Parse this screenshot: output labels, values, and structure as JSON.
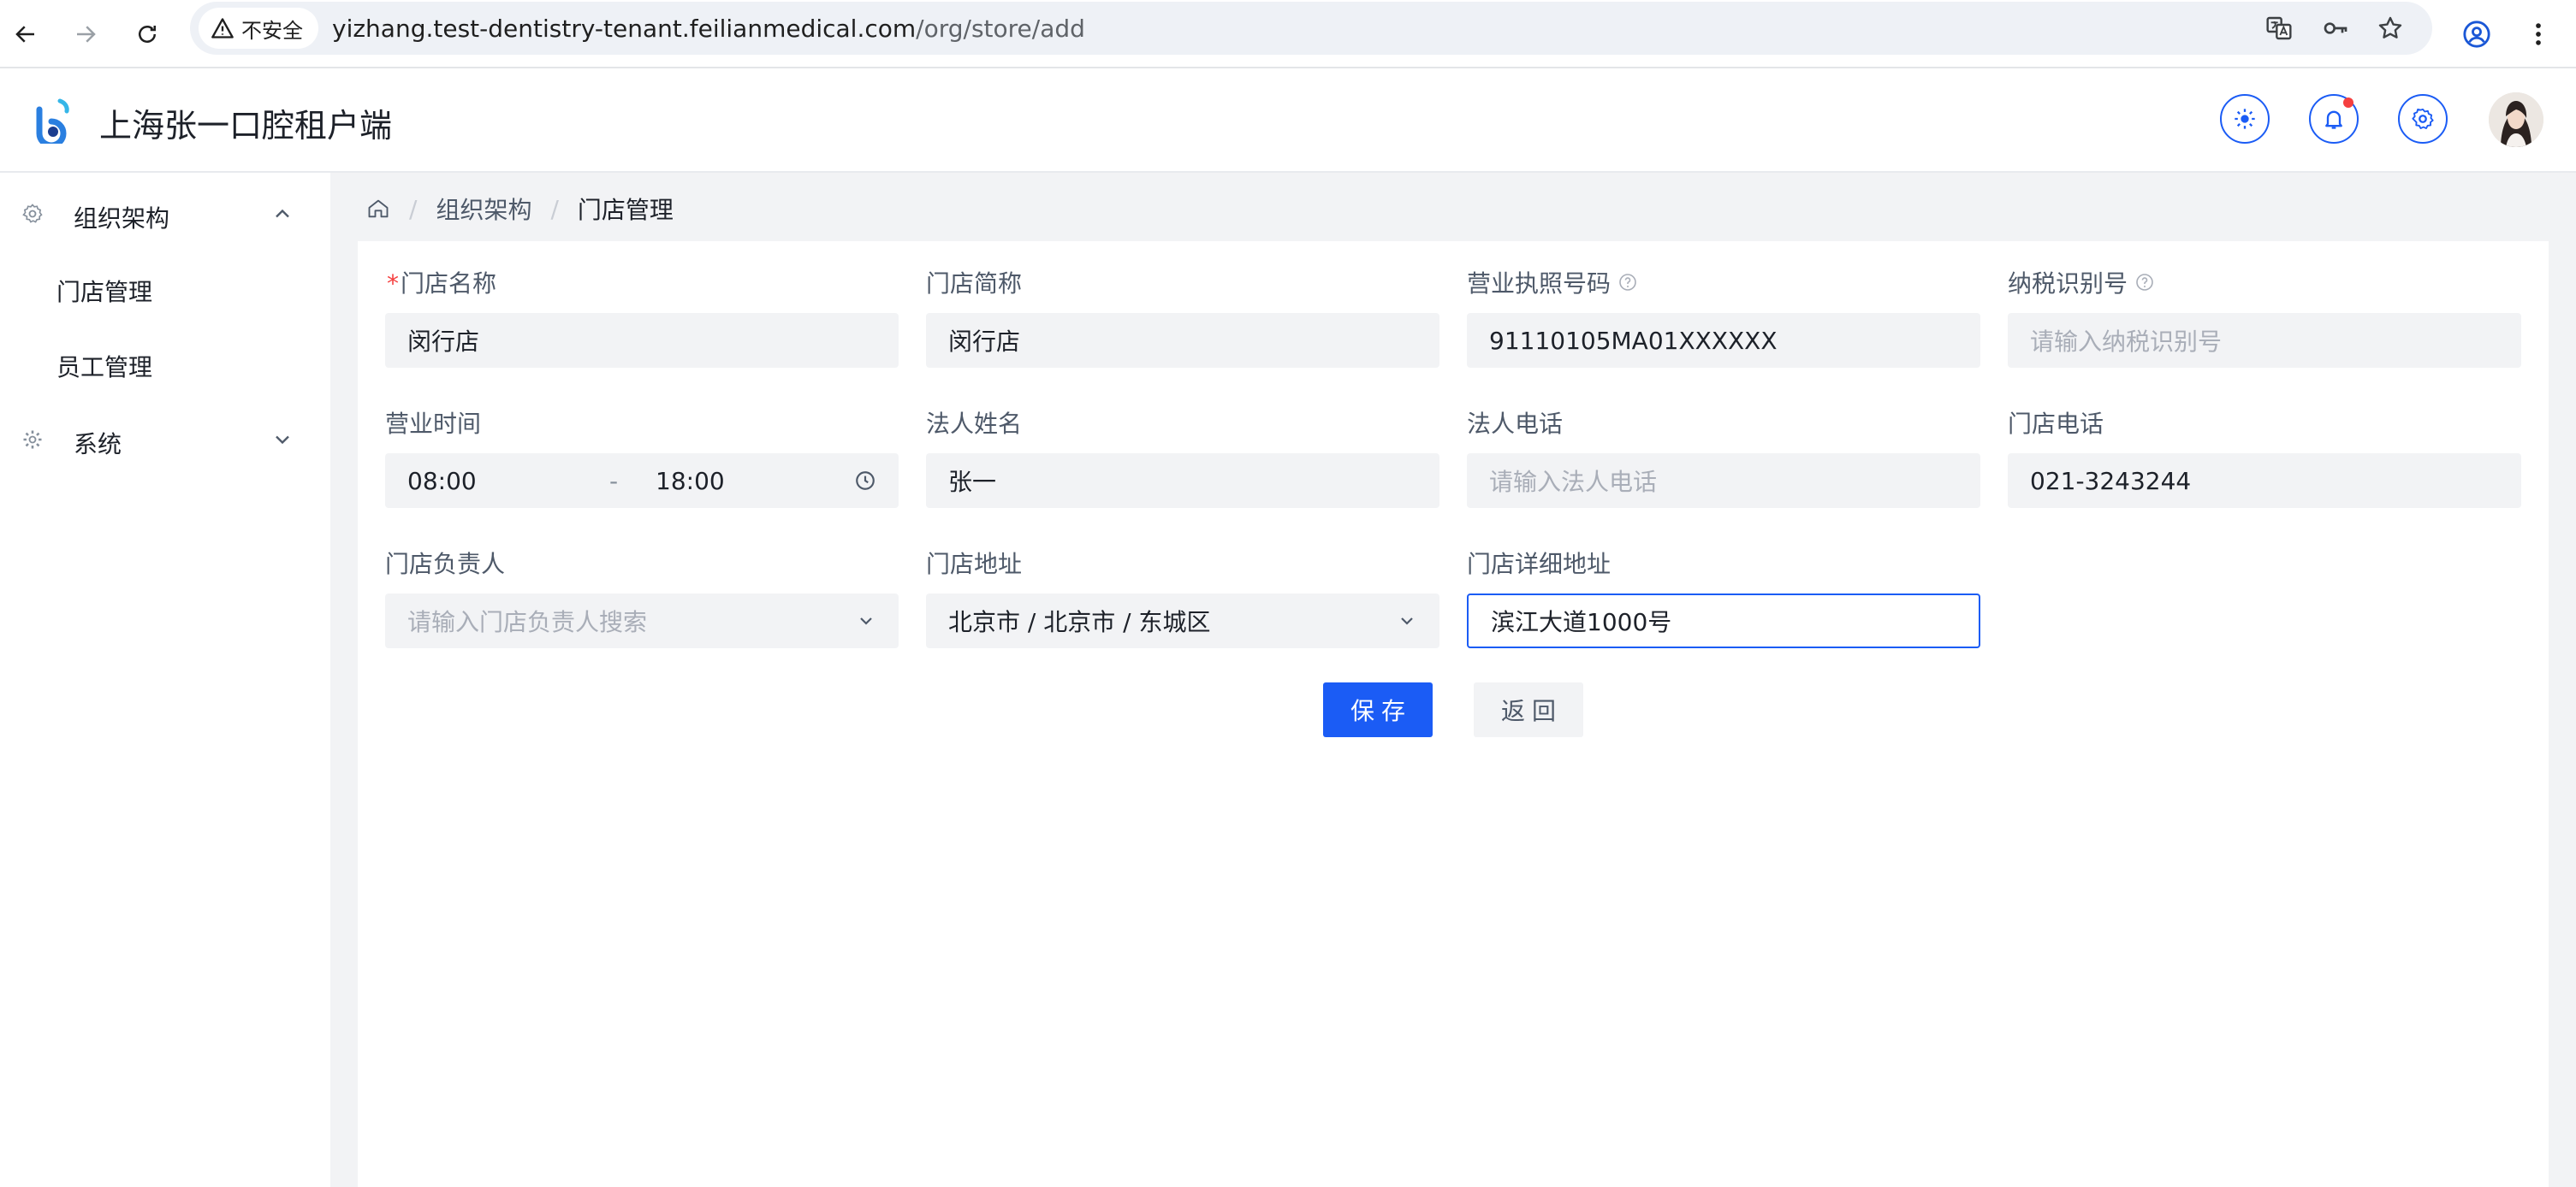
{
  "browser": {
    "security_label": "不安全",
    "url_host": "yizhang.test-dentistry-tenant.feilianmedical.com",
    "url_path": "/org/store/add"
  },
  "header": {
    "title": "上海张一口腔租户端"
  },
  "sidebar": {
    "groups": [
      {
        "label": "组织架构",
        "items": [
          "门店管理",
          "员工管理"
        ]
      },
      {
        "label": "系统"
      }
    ]
  },
  "breadcrumb": {
    "items": [
      "组织架构",
      "门店管理"
    ]
  },
  "form": {
    "store_name": {
      "label": "门店名称",
      "value": "闵行店",
      "required": true
    },
    "store_short_name": {
      "label": "门店简称",
      "value": "闵行店"
    },
    "license_no": {
      "label": "营业执照号码",
      "value": "91110105MA01XXXXXX"
    },
    "tax_id": {
      "label": "纳税识别号",
      "placeholder": "请输入纳税识别号"
    },
    "business_hours": {
      "label": "营业时间",
      "start": "08:00",
      "separator": "-",
      "end": "18:00"
    },
    "legal_name": {
      "label": "法人姓名",
      "value": "张一"
    },
    "legal_phone": {
      "label": "法人电话",
      "placeholder": "请输入法人电话"
    },
    "store_phone": {
      "label": "门店电话",
      "value": "021-3243244"
    },
    "manager": {
      "label": "门店负责人",
      "placeholder": "请输入门店负责人搜索"
    },
    "address": {
      "label": "门店地址",
      "value": "北京市 / 北京市 / 东城区"
    },
    "detail_address": {
      "label": "门店详细地址",
      "value": "滨江大道1000号"
    }
  },
  "actions": {
    "save": "保存",
    "back": "返回"
  },
  "colors": {
    "primary": "#1b5cf5",
    "required": "#f53f3f",
    "input_bg": "#f2f3f5"
  }
}
